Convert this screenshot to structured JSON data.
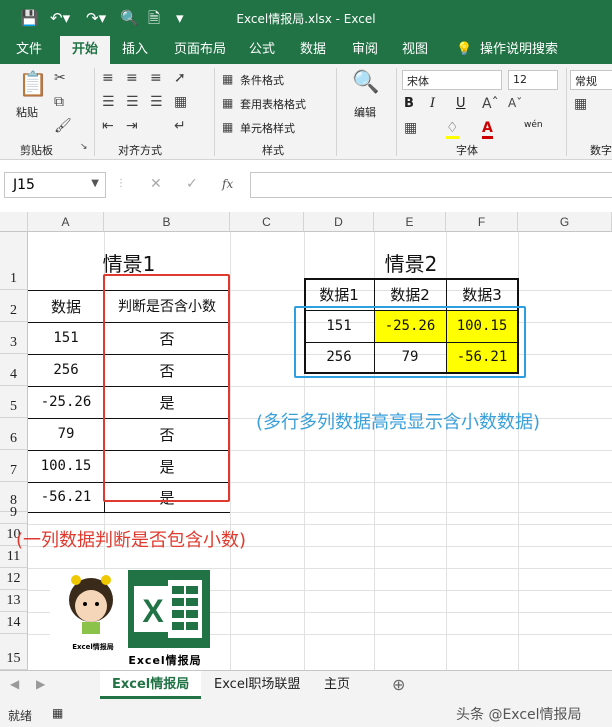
{
  "window": {
    "title": "Excel情报局.xlsx - Excel"
  },
  "tabs": [
    "文件",
    "开始",
    "插入",
    "页面布局",
    "公式",
    "数据",
    "审阅",
    "视图",
    "操作说明搜索"
  ],
  "active_tab": "开始",
  "ribbon": {
    "paste_label": "粘贴",
    "clipboard_label": "剪贴板",
    "alignment_label": "对齐方式",
    "styles": {
      "conditional": "条件格式",
      "table": "套用表格格式",
      "cell": "单元格样式",
      "label": "样式"
    },
    "editing_label": "编辑",
    "font": {
      "name": "宋体",
      "size": "12",
      "label": "字体",
      "bold": "B",
      "italic": "I",
      "underline": "U",
      "wen": "wén"
    },
    "number": {
      "format": "常规",
      "label": "数字"
    }
  },
  "formula_bar": {
    "name_box": "J15",
    "fx": "fx"
  },
  "columns": [
    "A",
    "B",
    "C",
    "D",
    "E",
    "F",
    "G"
  ],
  "rows": [
    "1",
    "2",
    "3",
    "4",
    "5",
    "6",
    "7",
    "8",
    "9",
    "10",
    "11",
    "12",
    "13",
    "14",
    "15"
  ],
  "scenario1": {
    "title": "情景1",
    "headers": [
      "数据",
      "判断是否含小数"
    ],
    "rows": [
      [
        "151",
        "否"
      ],
      [
        "256",
        "否"
      ],
      [
        "-25.26",
        "是"
      ],
      [
        "79",
        "否"
      ],
      [
        "100.15",
        "是"
      ],
      [
        "-56.21",
        "是"
      ]
    ],
    "caption": "(一列数据判断是否包含小数)"
  },
  "scenario2": {
    "title": "情景2",
    "headers": [
      "数据1",
      "数据2",
      "数据3"
    ],
    "rows": [
      [
        "151",
        "-25.26",
        "100.15"
      ],
      [
        "256",
        "79",
        "-56.21"
      ]
    ],
    "caption": "(多行多列数据高亮显示含小数数据)"
  },
  "logo": {
    "text": "Excel情报局",
    "badge": "Excel情报局"
  },
  "sheet_tabs": [
    "Excel情报局",
    "Excel职场联盟",
    "主页"
  ],
  "status": {
    "ready": "就绪",
    "watermark": "头条 @Excel情报局"
  },
  "colors": {
    "excel_green": "#217346",
    "highlight": "#ffff00",
    "red_box": "#e03a2e",
    "blue_box": "#2ea0e0",
    "caption_blue": "#3aa0dc"
  }
}
